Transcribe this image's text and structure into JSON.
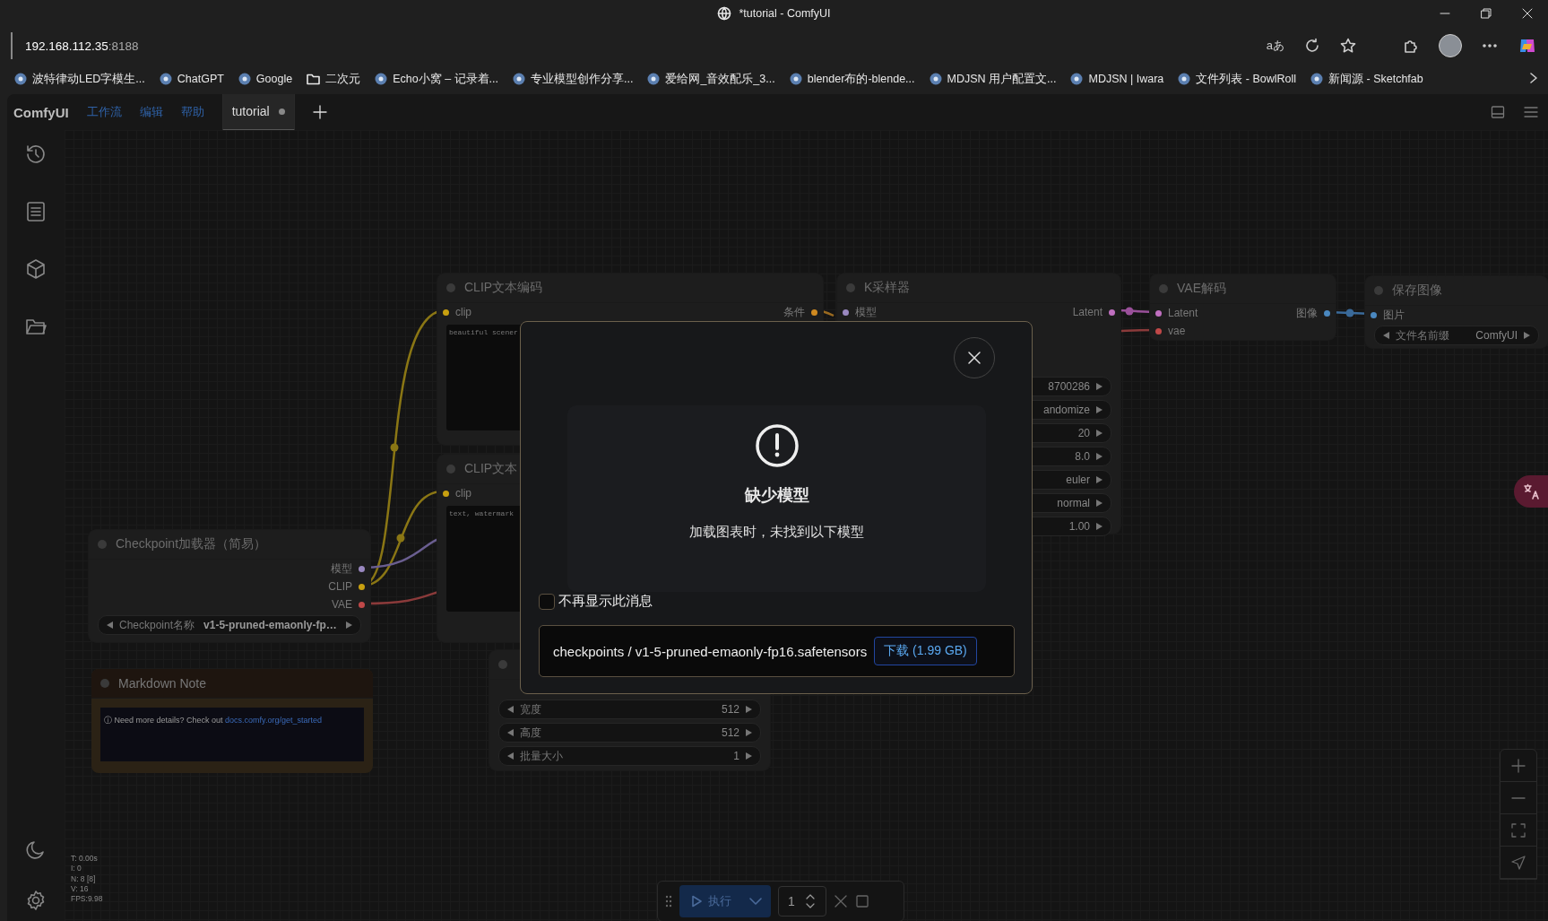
{
  "browser": {
    "title": "*tutorial - ComfyUI",
    "address_host": "192.168.112.35",
    "address_port": ":8188",
    "read_aloud": "aあ",
    "bookmarks": [
      {
        "label": "波特律动LED字模生...",
        "kind": "site"
      },
      {
        "label": "ChatGPT",
        "kind": "site"
      },
      {
        "label": "Google",
        "kind": "site"
      },
      {
        "label": "二次元",
        "kind": "folder"
      },
      {
        "label": "Echo小窝 – 记录着...",
        "kind": "site"
      },
      {
        "label": "专业模型创作分享...",
        "kind": "site"
      },
      {
        "label": "爱给网_音效配乐_3...",
        "kind": "site"
      },
      {
        "label": "blender布的-blende...",
        "kind": "site"
      },
      {
        "label": "MDJSN 用户配置文...",
        "kind": "site"
      },
      {
        "label": "MDJSN | Iwara",
        "kind": "site"
      },
      {
        "label": "文件列表 - BowlRoll",
        "kind": "site"
      },
      {
        "label": "新闻源 - Sketchfab",
        "kind": "site"
      }
    ]
  },
  "app": {
    "brand": "ComfyUI",
    "menus": [
      "工作流",
      "编辑",
      "帮助"
    ],
    "tabs": [
      {
        "label": "tutorial",
        "selected": true,
        "modified": true
      }
    ]
  },
  "nodes": [
    {
      "title": "CLIP文本编码",
      "inputs": [
        {
          "label": "clip",
          "color": "#c8a010"
        }
      ],
      "outputs": [
        {
          "label": "条件",
          "color": "#d08a20"
        }
      ],
      "text": "beautiful scener"
    },
    {
      "title": "CLIP文本",
      "inputs": [
        {
          "label": "clip",
          "color": "#c8a010"
        }
      ],
      "text": "text, watermark"
    },
    {
      "title": "K采样器",
      "inputs": [
        {
          "label": "模型",
          "color": "#9a88c0"
        }
      ],
      "outputs": [
        {
          "label": "Latent",
          "color": "#c070c0"
        }
      ],
      "widgets": [
        {
          "value": "8700286"
        },
        {
          "value": "andomize"
        },
        {
          "value": "20"
        },
        {
          "value": "8.0"
        },
        {
          "value": "euler"
        },
        {
          "value": "normal"
        },
        {
          "value": "1.00"
        }
      ]
    },
    {
      "title": "VAE解码",
      "inputs": [
        {
          "label": "Latent",
          "color": "#c070c0"
        },
        {
          "label": "vae",
          "color": "#c04848"
        }
      ],
      "outputs": [
        {
          "label": "图像",
          "color": "#4a88c0"
        }
      ]
    },
    {
      "title": "保存图像",
      "inputs": [
        {
          "label": "图片",
          "color": "#4a88c0"
        }
      ],
      "widgets": [
        {
          "label": "文件名前缀",
          "value": "ComfyUI"
        }
      ]
    },
    {
      "title": "Checkpoint加载器（简易）",
      "outputs": [
        {
          "label": "模型",
          "color": "#9a88c0"
        },
        {
          "label": "CLIP",
          "color": "#c8a010"
        },
        {
          "label": "VAE",
          "color": "#c04848"
        }
      ],
      "widgets": [
        {
          "label": "Checkpoint名称",
          "value": "v1-5-pruned-emaonly-fp…",
          "strong": true
        }
      ]
    },
    {
      "widgets": [
        {
          "label": "宽度",
          "value": "512"
        },
        {
          "label": "高度",
          "value": "512"
        },
        {
          "label": "批量大小",
          "value": "1"
        }
      ]
    }
  ],
  "note": {
    "title": "Markdown Note",
    "text": "ⓘ Need more details? Check out",
    "link": "docs.comfy.org/get_started"
  },
  "stats": [
    "T: 0.00s",
    "I: 0",
    "N: 8 [8]",
    "V: 16",
    "FPS:9.98"
  ],
  "toolbar": {
    "run_label": "执行",
    "batch_count": "1"
  },
  "dialog": {
    "title": "缺少模型",
    "message": "加载图表时，未找到以下模型",
    "dont_show_again": {
      "label": "不再显示此消息",
      "checked": false
    },
    "models": [
      {
        "path": "checkpoints / v1-5-pruned-emaonly-fp16.safetensors",
        "download": "下载 (1.99 GB)"
      }
    ]
  }
}
